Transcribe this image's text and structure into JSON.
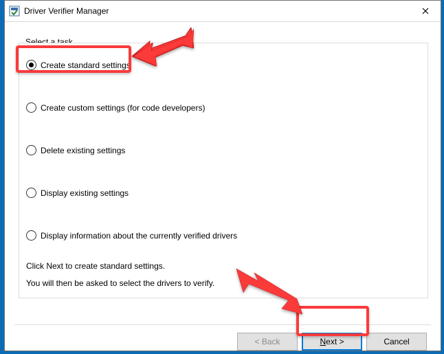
{
  "window": {
    "title": "Driver Verifier Manager"
  },
  "panel": {
    "task_label": "Select a task",
    "options": [
      "Create standard settings",
      "Create custom settings (for code developers)",
      "Delete existing settings",
      "Display existing settings",
      "Display information about the currently verified drivers"
    ],
    "selected_index": 0,
    "instruction_line1": "Click Next to create standard settings.",
    "instruction_line2": "You will then be asked to select the drivers to verify."
  },
  "buttons": {
    "back": "< Back",
    "next_underline": "N",
    "next_rest": "ext >",
    "cancel": "Cancel"
  },
  "annotations": {
    "highlight_option": 0,
    "highlight_button": "next",
    "arrows": 2,
    "color": "#fb3a3a"
  }
}
